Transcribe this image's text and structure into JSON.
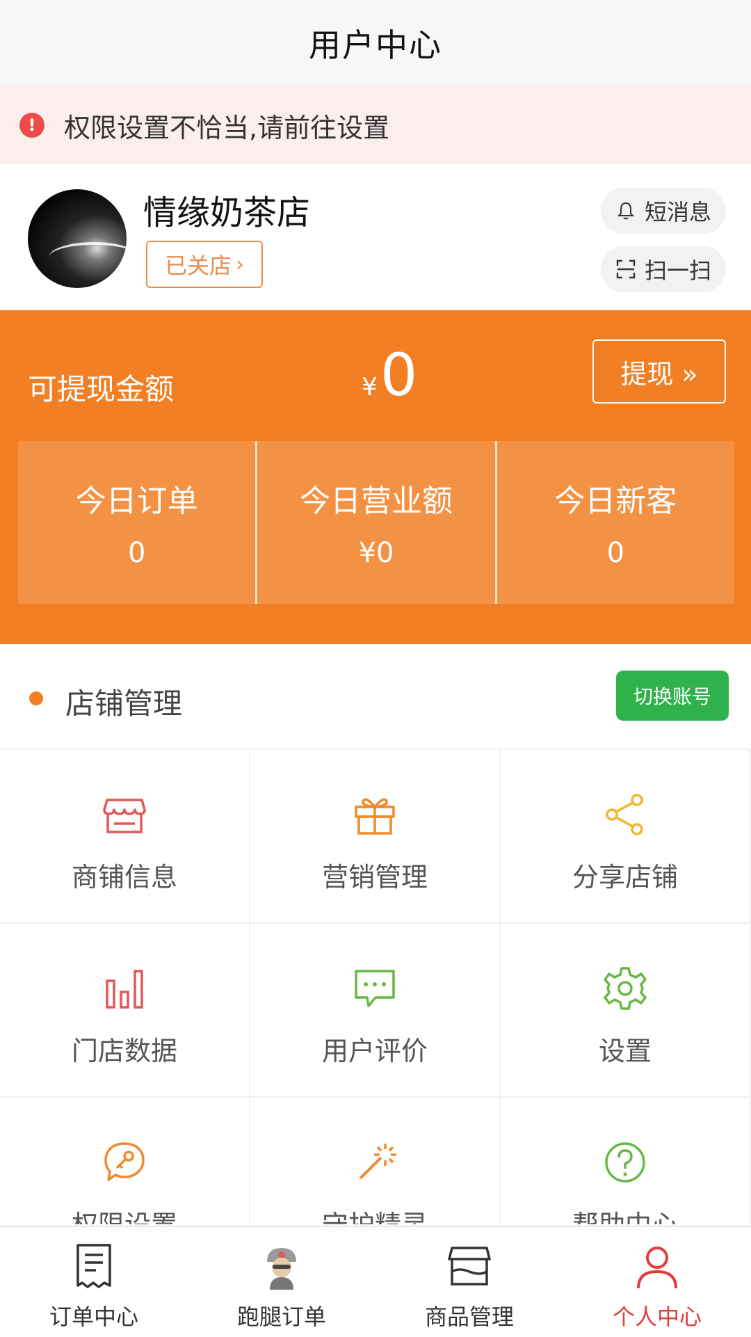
{
  "header": {
    "title": "用户中心"
  },
  "alert": {
    "text": "权限设置不恰当,请前往设置"
  },
  "profile": {
    "shop_name": "情缘奶茶店",
    "status_label": "已关店",
    "message_label": "短消息",
    "scan_label": "扫一扫"
  },
  "wallet": {
    "label": "可提现金额",
    "currency": "¥",
    "amount": "0",
    "withdraw_label": "提现 »"
  },
  "stats": [
    {
      "label": "今日订单",
      "value": "0"
    },
    {
      "label": "今日营业额",
      "value": "¥0"
    },
    {
      "label": "今日新客",
      "value": "0"
    }
  ],
  "section": {
    "title": "店铺管理",
    "switch_label": "切换账号"
  },
  "grid": [
    {
      "label": "商铺信息",
      "icon": "store-icon",
      "color": "#e05858"
    },
    {
      "label": "营销管理",
      "icon": "gift-icon",
      "color": "#f08a2c"
    },
    {
      "label": "分享店铺",
      "icon": "share-icon",
      "color": "#f2b52e"
    },
    {
      "label": "门店数据",
      "icon": "bar-chart-icon",
      "color": "#e05858"
    },
    {
      "label": "用户评价",
      "icon": "comment-icon",
      "color": "#67b842"
    },
    {
      "label": "设置",
      "icon": "gear-icon",
      "color": "#67b842"
    },
    {
      "label": "权限设置",
      "icon": "key-chat-icon",
      "color": "#f08a2c"
    },
    {
      "label": "守护精灵",
      "icon": "magic-wand-icon",
      "color": "#f08a2c"
    },
    {
      "label": "帮助中心",
      "icon": "help-icon",
      "color": "#67b842"
    }
  ],
  "tabbar": [
    {
      "label": "订单中心",
      "icon": "document-icon"
    },
    {
      "label": "跑腿订单",
      "icon": "courier-icon"
    },
    {
      "label": "商品管理",
      "icon": "box-icon"
    },
    {
      "label": "个人中心",
      "icon": "person-icon",
      "active": true
    }
  ],
  "colors": {
    "accent": "#f27f24",
    "green": "#2fb14b",
    "alert_bg": "#fdeeee",
    "active_tab": "#e23b3b"
  }
}
